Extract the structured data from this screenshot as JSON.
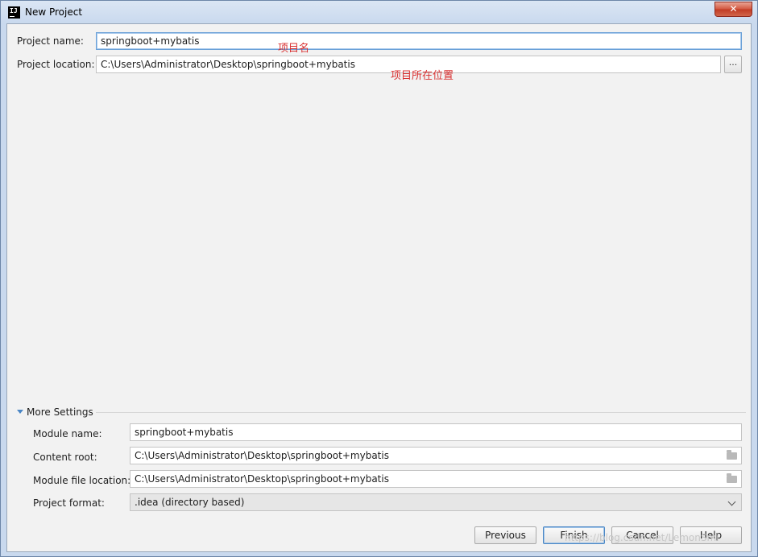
{
  "window": {
    "title": "New Project",
    "close_label": "✕",
    "app_icon_label": "IJ"
  },
  "form": {
    "project_name_label": "Project name:",
    "project_name_value": "springboot+mybatis",
    "project_name_annotation": "项目名",
    "project_location_label": "Project location:",
    "project_location_value": "C:\\Users\\Administrator\\Desktop\\springboot+mybatis",
    "project_location_annotation": "项目所在位置",
    "browse_label": "..."
  },
  "more_settings": {
    "title": "More Settings",
    "module_name_label": "Module name:",
    "module_name_value": "springboot+mybatis",
    "content_root_label": "Content root:",
    "content_root_value": "C:\\Users\\Administrator\\Desktop\\springboot+mybatis",
    "module_file_location_label": "Module file location:",
    "module_file_location_value": "C:\\Users\\Administrator\\Desktop\\springboot+mybatis",
    "project_format_label": "Project format:",
    "project_format_value": ".idea (directory based)"
  },
  "buttons": {
    "previous": "Previous",
    "finish": "Finish",
    "cancel": "Cancel",
    "help": "Help"
  },
  "watermark": "https://blog.csdn.net/LemonSmi"
}
